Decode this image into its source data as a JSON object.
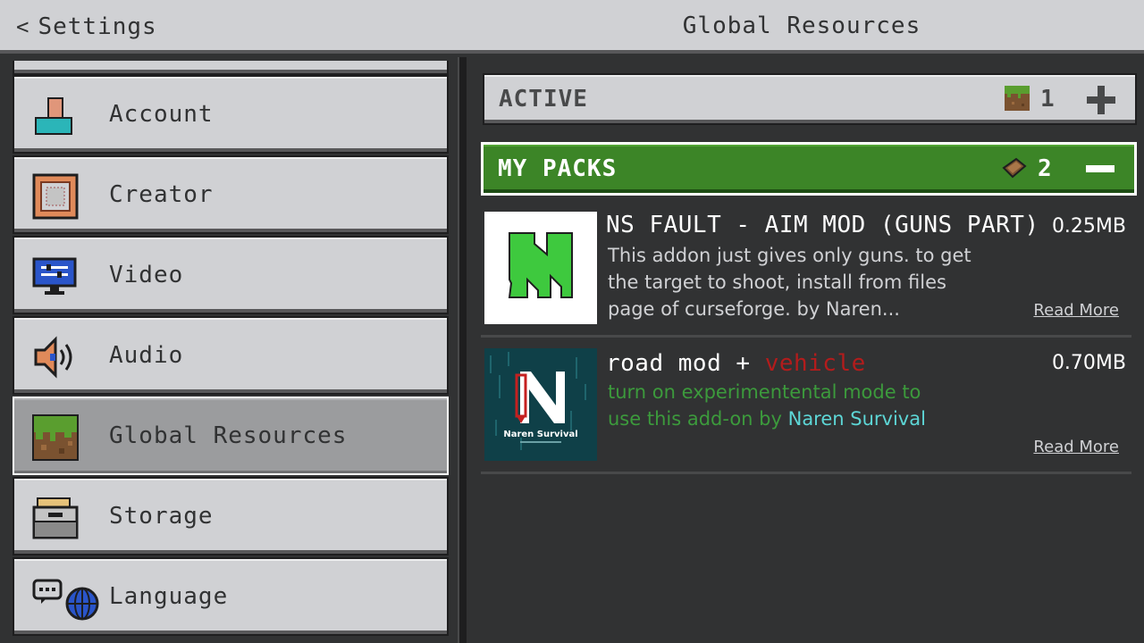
{
  "header": {
    "back_label": "Settings",
    "title": "Global Resources"
  },
  "sidebar": {
    "items": [
      {
        "label": "Account",
        "icon": "account-icon"
      },
      {
        "label": "Creator",
        "icon": "creator-icon"
      },
      {
        "label": "Video",
        "icon": "video-icon"
      },
      {
        "label": "Audio",
        "icon": "audio-icon"
      },
      {
        "label": "Global Resources",
        "icon": "global-resources-icon",
        "selected": true
      },
      {
        "label": "Storage",
        "icon": "storage-icon"
      },
      {
        "label": "Language",
        "icon": "language-icon"
      }
    ]
  },
  "active": {
    "title": "ACTIVE",
    "count": "1",
    "toggle": "plus-icon"
  },
  "my_packs": {
    "title": "MY PACKS",
    "count": "2",
    "toggle": "minus-icon",
    "packs": [
      {
        "name": "NS FAULT - AIM MOD (GUNS PART)",
        "size": "0.25MB",
        "description": "This addon just gives only guns. to get the target to shoot, install from files page of curseforge. by Naren...",
        "read_more": "Read More"
      },
      {
        "name_part1": "road mod + ",
        "name_part2": "vehicle",
        "size": "0.70MB",
        "description_part1": "turn on experimentental mode to use this add-on by ",
        "description_part2": "Naren Survival",
        "thumb_text": "Naren Survival",
        "read_more": "Read More"
      }
    ]
  },
  "colors": {
    "green": "#3c8527",
    "desc_green": "#3c9a3c",
    "desc_cyan": "#5dd6d6",
    "name_red": "#b31c1c"
  }
}
